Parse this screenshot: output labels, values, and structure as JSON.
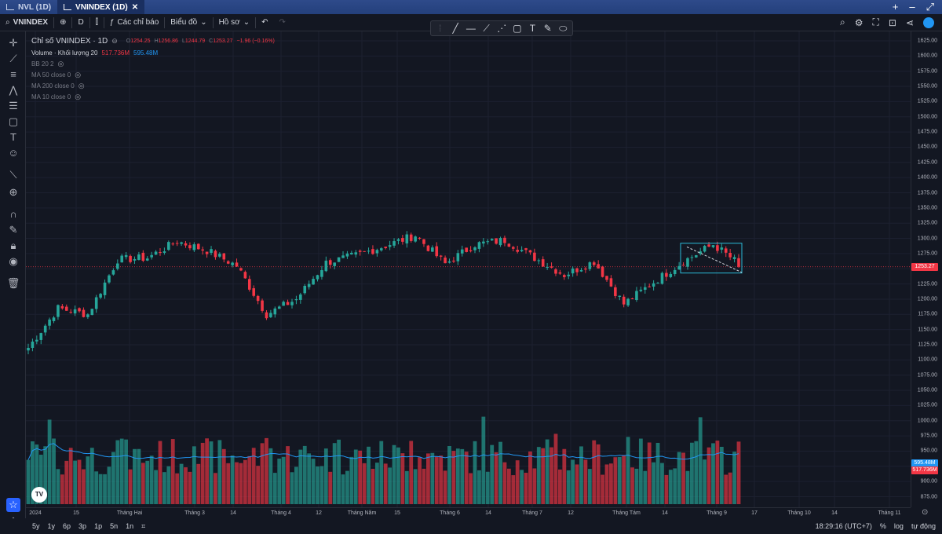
{
  "tabs": [
    {
      "label": "NVL (1D)",
      "active": false
    },
    {
      "label": "VNINDEX (1D)",
      "active": true
    }
  ],
  "tabs_right": [
    "+",
    "–",
    "⤢"
  ],
  "toolbar": {
    "symbol": "VNINDEX",
    "interval": "D",
    "indicators": "Các chỉ báo",
    "chart_menu": "Biểu đồ",
    "profile": "Hồ sơ"
  },
  "legend": {
    "title": "Chỉ số VNINDEX · 1D",
    "o_label": "O",
    "o": "1254.25",
    "h_label": "H",
    "h": "1256.86",
    "l_label": "L",
    "l": "1244.79",
    "c_label": "C",
    "c": "1253.27",
    "change": "−1.96 (−0.16%)",
    "volume_label": "Volume · Khối lượng 20",
    "volume_value": "517.736M",
    "volume_ma": "595.48M",
    "indicators": [
      "BB 20 2",
      "MA 50 close 0",
      "MA 200 close 0",
      "MA 10 close 0"
    ]
  },
  "price_axis": {
    "labels": [
      "1625.00",
      "1600.00",
      "1575.00",
      "1550.00",
      "1525.00",
      "1500.00",
      "1475.00",
      "1450.00",
      "1425.00",
      "1400.00",
      "1375.00",
      "1350.00",
      "1325.00",
      "1300.00",
      "1275.00",
      "1250.00",
      "1225.00",
      "1200.00",
      "1175.00",
      "1150.00",
      "1125.00",
      "1100.00",
      "1075.00",
      "1050.00",
      "1025.00",
      "1000.00",
      "975.00",
      "950.00",
      "925.00",
      "900.00",
      "875.00"
    ],
    "current_price": "1253.27",
    "volume_ma_tag": "595.48M",
    "volume_tag": "517.736M"
  },
  "time_axis": [
    "2024",
    "15",
    "Tháng Hai",
    "Tháng 3",
    "14",
    "Tháng 4",
    "12",
    "Tháng Năm",
    "15",
    "Tháng 6",
    "14",
    "Tháng 7",
    "12",
    "Tháng Tám",
    "14",
    "Tháng 9",
    "17",
    "Tháng 10",
    "14",
    "Tháng 11"
  ],
  "ranges": [
    "5y",
    "1y",
    "6p",
    "3p",
    "1p",
    "5n",
    "1n"
  ],
  "bottom_right": {
    "time": "18:29:16 (UTC+7)",
    "percent": "%",
    "log": "log",
    "auto": "tự động"
  },
  "colors": {
    "up": "#26a69a",
    "down": "#f23645",
    "background": "#131722",
    "ma_line": "#2196f3",
    "box": "#2bbbd8"
  },
  "chart_data": {
    "type": "candlestick",
    "title": "Chỉ số VNINDEX · 1D",
    "ylim": [
      875,
      1625
    ],
    "segments": [
      [
        1120,
        1185
      ],
      [
        1185,
        1175
      ],
      [
        1175,
        1265
      ],
      [
        1265,
        1268
      ],
      [
        1268,
        1295
      ],
      [
        1295,
        1280
      ],
      [
        1280,
        1255
      ],
      [
        1255,
        1175
      ],
      [
        1175,
        1200
      ],
      [
        1200,
        1260
      ],
      [
        1260,
        1272
      ],
      [
        1272,
        1288
      ],
      [
        1288,
        1305
      ],
      [
        1305,
        1258
      ],
      [
        1258,
        1290
      ],
      [
        1290,
        1297
      ],
      [
        1297,
        1268
      ],
      [
        1268,
        1240
      ],
      [
        1240,
        1262
      ],
      [
        1262,
        1192
      ],
      [
        1192,
        1228
      ],
      [
        1228,
        1262
      ],
      [
        1262,
        1290
      ],
      [
        1290,
        1253
      ]
    ],
    "volume_ma_last": 595.48,
    "volume_last": 517.736
  }
}
